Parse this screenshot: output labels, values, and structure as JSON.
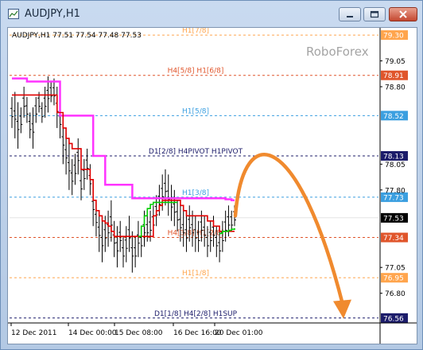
{
  "window": {
    "title": "AUDJPY,H1"
  },
  "chart_info": {
    "header": "AUDJPY,H1  77.51 77.54 77.48 77.53",
    "watermark": "RoboForex"
  },
  "chart_data": {
    "type": "line",
    "symbol": "AUDJPY",
    "timeframe": "H1",
    "ohlc": {
      "open": 77.51,
      "high": 77.54,
      "low": 77.48,
      "close": 77.53
    },
    "current_price": 77.53,
    "current_price_label": "77.53",
    "ylim": [
      76.52,
      79.37
    ],
    "y_ticks": [
      {
        "value": 79.05,
        "label": "79.05"
      },
      {
        "value": 78.8,
        "label": "78.80"
      },
      {
        "value": 78.05,
        "label": "78.05"
      },
      {
        "value": 77.8,
        "label": "77.80"
      },
      {
        "value": 77.05,
        "label": "77.05"
      },
      {
        "value": 76.8,
        "label": "76.80"
      }
    ],
    "x_ticks": [
      "12 Dec 2011",
      "14 Dec 00:00",
      "15 Dec 08:00",
      "16 Dec 16:00",
      "20 Dec 01:00"
    ],
    "levels": [
      {
        "price": 79.3,
        "price_label": "79.30",
        "label": "H1[7/8]",
        "color": "#ffa54d",
        "tag_color": "#ffa54d"
      },
      {
        "price": 78.91,
        "price_label": "78.91",
        "label": "H4[5/8] H1[6/8]",
        "color": "#e0552b",
        "tag_color": "#e0552b"
      },
      {
        "price": 78.52,
        "price_label": "78.52",
        "label": "H1[5/8]",
        "color": "#3b9fe0",
        "tag_color": "#3b9fe0"
      },
      {
        "price": 78.13,
        "price_label": "78.13",
        "label": "D1[2/8] H4PIVOT H1PIVOT",
        "color": "#1c1c6a",
        "tag_color": "#1c1c6a"
      },
      {
        "price": 77.73,
        "price_label": "77.73",
        "label": "H1[3/8]",
        "color": "#3b9fe0",
        "tag_color": "#3b9fe0"
      },
      {
        "price": 77.34,
        "price_label": "77.34",
        "label": "H4[3/8] H1[2/8]",
        "color": "#e0552b",
        "tag_color": "#e0552b"
      },
      {
        "price": 76.95,
        "price_label": "76.95",
        "label": "H1[1/8]",
        "color": "#ffa54d",
        "tag_color": "#ffa54d"
      },
      {
        "price": 76.56,
        "price_label": "76.56",
        "label": "D1[1/8] H4[2/8] H1SUP",
        "color": "#1c1c6a",
        "tag_color": "#1c1c6a"
      }
    ],
    "price_bars": [
      [
        78.7,
        78.4
      ],
      [
        78.75,
        78.3
      ],
      [
        78.65,
        78.2
      ],
      [
        78.6,
        78.35
      ],
      [
        78.8,
        78.5
      ],
      [
        78.7,
        78.45
      ],
      [
        78.55,
        78.3
      ],
      [
        78.6,
        78.2
      ],
      [
        78.7,
        78.45
      ],
      [
        78.75,
        78.55
      ],
      [
        78.65,
        78.45
      ],
      [
        78.8,
        78.5
      ],
      [
        78.9,
        78.55
      ],
      [
        78.85,
        78.65
      ],
      [
        78.88,
        78.62
      ],
      [
        78.8,
        78.4
      ],
      [
        78.65,
        78.3
      ],
      [
        78.5,
        78.05
      ],
      [
        78.35,
        77.95
      ],
      [
        78.25,
        77.8
      ],
      [
        78.1,
        77.75
      ],
      [
        78.15,
        77.85
      ],
      [
        78.3,
        77.95
      ],
      [
        78.0,
        77.7
      ],
      [
        78.1,
        77.8
      ],
      [
        78.2,
        77.9
      ],
      [
        78.05,
        77.75
      ],
      [
        77.85,
        77.45
      ],
      [
        77.7,
        77.35
      ],
      [
        77.6,
        77.2
      ],
      [
        77.5,
        77.1
      ],
      [
        77.55,
        77.2
      ],
      [
        77.6,
        77.25
      ],
      [
        77.7,
        77.3
      ],
      [
        77.5,
        77.15
      ],
      [
        77.45,
        77.05
      ],
      [
        77.5,
        77.2
      ],
      [
        77.35,
        77.05
      ],
      [
        77.45,
        77.1
      ],
      [
        77.55,
        77.2
      ],
      [
        77.4,
        77.0
      ],
      [
        77.35,
        77.05
      ],
      [
        77.5,
        77.15
      ],
      [
        77.45,
        77.15
      ],
      [
        77.6,
        77.25
      ],
      [
        77.55,
        77.3
      ],
      [
        77.6,
        77.3
      ],
      [
        77.65,
        77.35
      ],
      [
        77.75,
        77.45
      ],
      [
        77.85,
        77.55
      ],
      [
        77.95,
        77.6
      ],
      [
        78.0,
        77.65
      ],
      [
        77.95,
        77.55
      ],
      [
        77.85,
        77.5
      ],
      [
        77.8,
        77.45
      ],
      [
        77.7,
        77.4
      ],
      [
        77.65,
        77.3
      ],
      [
        77.6,
        77.25
      ],
      [
        77.55,
        77.2
      ],
      [
        77.65,
        77.3
      ],
      [
        77.6,
        77.25
      ],
      [
        77.55,
        77.2
      ],
      [
        77.5,
        77.2
      ],
      [
        77.6,
        77.3
      ],
      [
        77.55,
        77.25
      ],
      [
        77.45,
        77.15
      ],
      [
        77.5,
        77.2
      ],
      [
        77.55,
        77.25
      ],
      [
        77.45,
        77.15
      ],
      [
        77.4,
        77.1
      ],
      [
        77.5,
        77.2
      ],
      [
        77.6,
        77.3
      ],
      [
        77.65,
        77.35
      ],
      [
        77.6,
        77.4
      ],
      [
        77.65,
        77.45
      ]
    ],
    "series": [
      {
        "name": "",
        "color": "#ff33ff",
        "y": [
          78.88,
          78.88,
          78.88,
          78.88,
          78.88,
          78.85,
          78.85,
          78.85,
          78.85,
          78.85,
          78.85,
          78.85,
          78.85,
          78.85,
          78.85,
          78.85,
          78.52,
          78.52,
          78.52,
          78.52,
          78.52,
          78.52,
          78.52,
          78.52,
          78.52,
          78.52,
          78.52,
          78.13,
          78.13,
          78.13,
          78.13,
          77.85,
          77.85,
          77.85,
          77.85,
          77.85,
          77.85,
          77.85,
          77.85,
          77.85,
          77.72,
          77.72,
          77.72,
          77.72,
          77.72,
          77.72,
          77.72,
          77.72,
          77.72,
          77.72,
          77.72,
          77.72,
          77.72,
          77.72,
          77.72,
          77.72,
          77.72,
          77.72,
          77.72,
          77.72,
          77.72,
          77.72,
          77.72,
          77.72,
          77.72,
          77.72,
          77.72,
          77.72,
          77.72,
          77.72,
          77.72,
          77.71,
          77.71,
          77.7,
          77.7
        ]
      },
      {
        "name": "",
        "color": "#e00000",
        "y": [
          78.72,
          78.72,
          78.72,
          78.72,
          78.72,
          78.72,
          78.72,
          78.72,
          78.72,
          78.72,
          78.72,
          78.72,
          78.72,
          78.72,
          78.72,
          78.55,
          78.55,
          78.4,
          78.3,
          78.25,
          78.2,
          78.2,
          78.2,
          78.0,
          78.0,
          78.0,
          77.9,
          77.7,
          77.6,
          77.55,
          77.5,
          77.48,
          77.45,
          77.4,
          77.35,
          77.35,
          77.35,
          77.35,
          77.35,
          77.35,
          77.35,
          77.35,
          77.35,
          77.35,
          77.35,
          77.35,
          77.35,
          77.55,
          77.6,
          77.65,
          77.7,
          77.7,
          77.7,
          77.7,
          77.7,
          77.7,
          77.65,
          77.6,
          77.55,
          77.55,
          77.55,
          77.55,
          77.55,
          77.55,
          77.55,
          77.5,
          77.5,
          77.45,
          77.45,
          77.4,
          77.4,
          77.4,
          77.4,
          77.4,
          77.4
        ]
      },
      {
        "name": "",
        "color": "#00cc00",
        "y": [
          null,
          null,
          null,
          null,
          null,
          null,
          null,
          null,
          null,
          null,
          null,
          null,
          null,
          null,
          null,
          null,
          null,
          null,
          null,
          null,
          null,
          null,
          null,
          null,
          null,
          null,
          null,
          null,
          null,
          null,
          null,
          null,
          null,
          null,
          null,
          null,
          null,
          null,
          null,
          null,
          null,
          null,
          77.35,
          77.45,
          77.55,
          77.62,
          77.66,
          77.68,
          77.68,
          77.68,
          77.68,
          77.68,
          77.68,
          77.68,
          77.68,
          77.68,
          null,
          null,
          null,
          null,
          null,
          null,
          null,
          null,
          null,
          null,
          null,
          null,
          null,
          77.38,
          77.4,
          77.4,
          77.41,
          77.42,
          77.43
        ]
      }
    ],
    "forecast_arrow": {
      "color": "#f08a2e",
      "from_price": 77.55,
      "peak_price": 78.05,
      "to_price": 76.6
    }
  }
}
